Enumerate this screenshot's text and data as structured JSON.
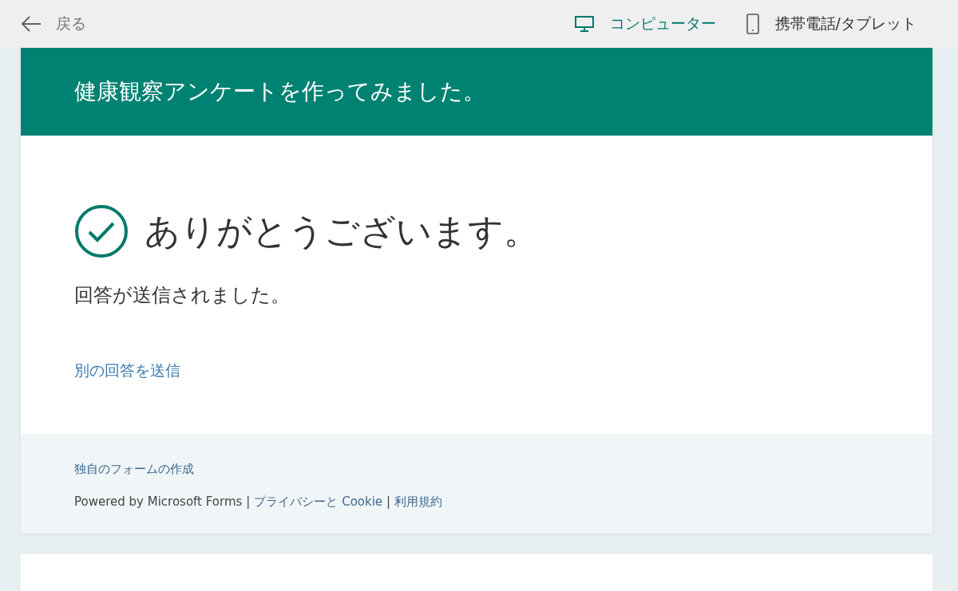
{
  "top_bar": {
    "back": {
      "label": "戻る"
    },
    "views": [
      {
        "kind": "computer",
        "label": "コンピューター",
        "selected": true
      },
      {
        "kind": "phone",
        "label": "携帯電話/タブレット",
        "selected": false
      }
    ]
  },
  "form": {
    "title": "健康観察アンケートを作ってみました。",
    "heading": "ありがとうございます。",
    "message": "回答が送信されました。",
    "link": "別の回答を送信"
  },
  "footer": {
    "create_link": "独自のフォームの作成",
    "line": [
      {
        "kind": "text",
        "text": "Powered by Microsoft Forms"
      },
      {
        "kind": "separator",
        "text": "|"
      },
      {
        "kind": "link",
        "text": "プライバシーと Cookie"
      },
      {
        "kind": "separator",
        "text": "|"
      },
      {
        "kind": "link",
        "text": "利用規約"
      }
    ]
  }
}
